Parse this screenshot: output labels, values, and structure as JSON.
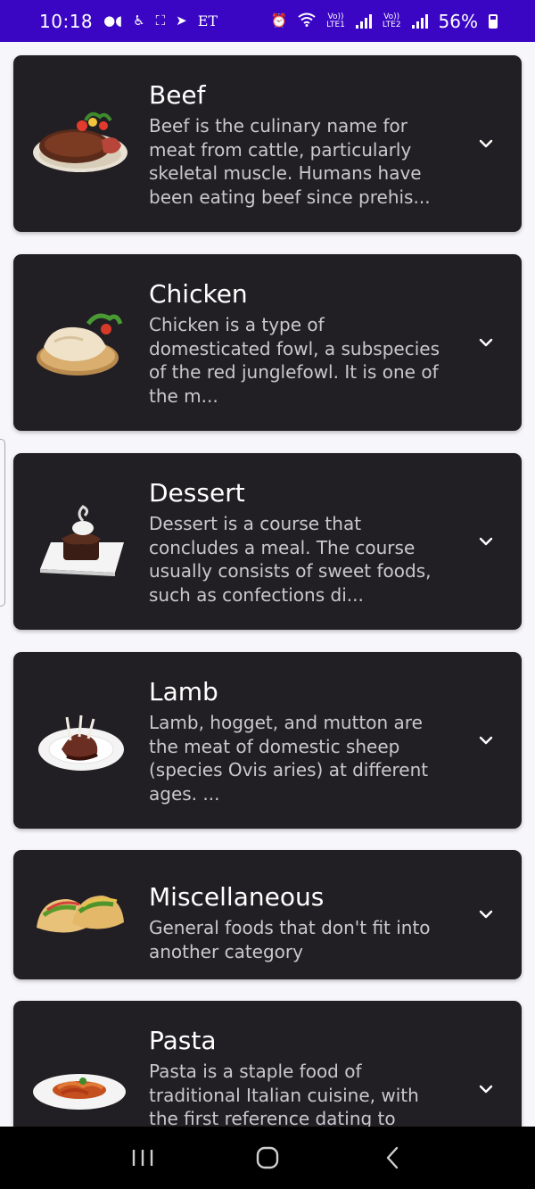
{
  "status_bar": {
    "time": "10:18",
    "carrier_tag": "ET",
    "net1_top": "Vo))",
    "net1_bottom": "LTE1",
    "net2_top": "Vo))",
    "net2_bottom": "LTE2",
    "battery": "56%"
  },
  "categories": [
    {
      "title": "Beef",
      "description": "Beef is the culinary name for meat from cattle, particularly skeletal muscle. Humans have been eating beef since prehis...",
      "image": "beef-steak-plate"
    },
    {
      "title": "Chicken",
      "description": "Chicken is a type of domesticated fowl, a subspecies of the red junglefowl. It is one of the m...",
      "image": "roast-chicken-board"
    },
    {
      "title": "Dessert",
      "description": "Dessert is a course that concludes a meal. The course usually consists of sweet foods, such as confections di...",
      "image": "chocolate-cake-plate"
    },
    {
      "title": "Lamb",
      "description": "Lamb, hogget, and mutton are the meat of domestic sheep (species Ovis aries) at different ages. ...",
      "image": "lamb-chops-plate"
    },
    {
      "title": "Miscellaneous",
      "description": "General foods that don't fit into another category",
      "image": "tacos"
    },
    {
      "title": "Pasta",
      "description": "Pasta is a staple food of traditional Italian cuisine, with the first reference dating to",
      "image": "pasta-plate"
    }
  ],
  "icons": {
    "expand": "chevron-down-icon",
    "nav_recents": "recents-icon",
    "nav_home": "home-icon",
    "nav_back": "back-icon"
  },
  "colors": {
    "status_bar": "#3a06c4",
    "background": "#f7f6fb",
    "card": "#211f23",
    "title": "#ffffff",
    "description": "#cac7cf",
    "nav_bar": "#000000"
  }
}
